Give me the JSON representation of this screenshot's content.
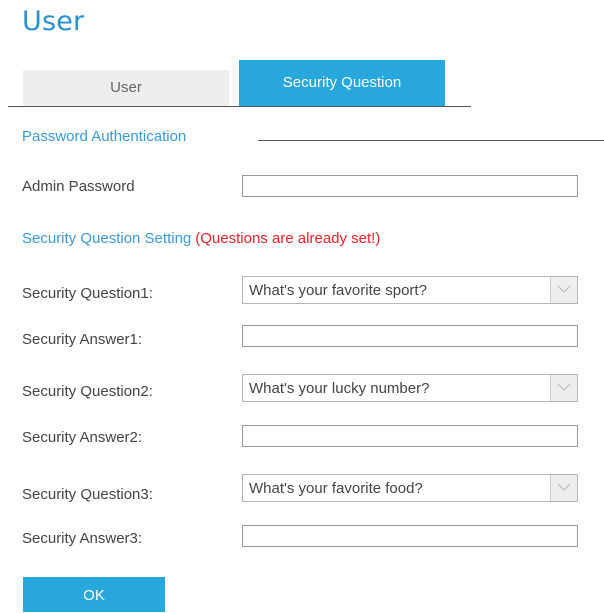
{
  "page": {
    "title": "User"
  },
  "tabs": [
    {
      "label": "User",
      "active": false
    },
    {
      "label": "Security Question",
      "active": true
    }
  ],
  "password_section": {
    "header": "Password Authentication",
    "admin_password_label": "Admin Password",
    "admin_password_value": ""
  },
  "security_section": {
    "header": "Security Question Setting",
    "note": "(Questions are already set!)",
    "rows": [
      {
        "question_label": "Security Question1:",
        "question_value": "What's your favorite sport?",
        "answer_label": "Security Answer1:",
        "answer_value": ""
      },
      {
        "question_label": "Security Question2:",
        "question_value": "What's your lucky number?",
        "answer_label": "Security Answer2:",
        "answer_value": ""
      },
      {
        "question_label": "Security Question3:",
        "question_value": "What's your favorite food?",
        "answer_label": "Security Answer3:",
        "answer_value": ""
      }
    ]
  },
  "actions": {
    "ok_label": "OK"
  },
  "colors": {
    "accent": "#27a7db",
    "title": "#2a8fcf",
    "section_header": "#3a9ad6",
    "warning": "#e8222b",
    "inactive_tab": "#eeeeee"
  },
  "icons": {
    "dropdown": "chevron-down-icon"
  }
}
